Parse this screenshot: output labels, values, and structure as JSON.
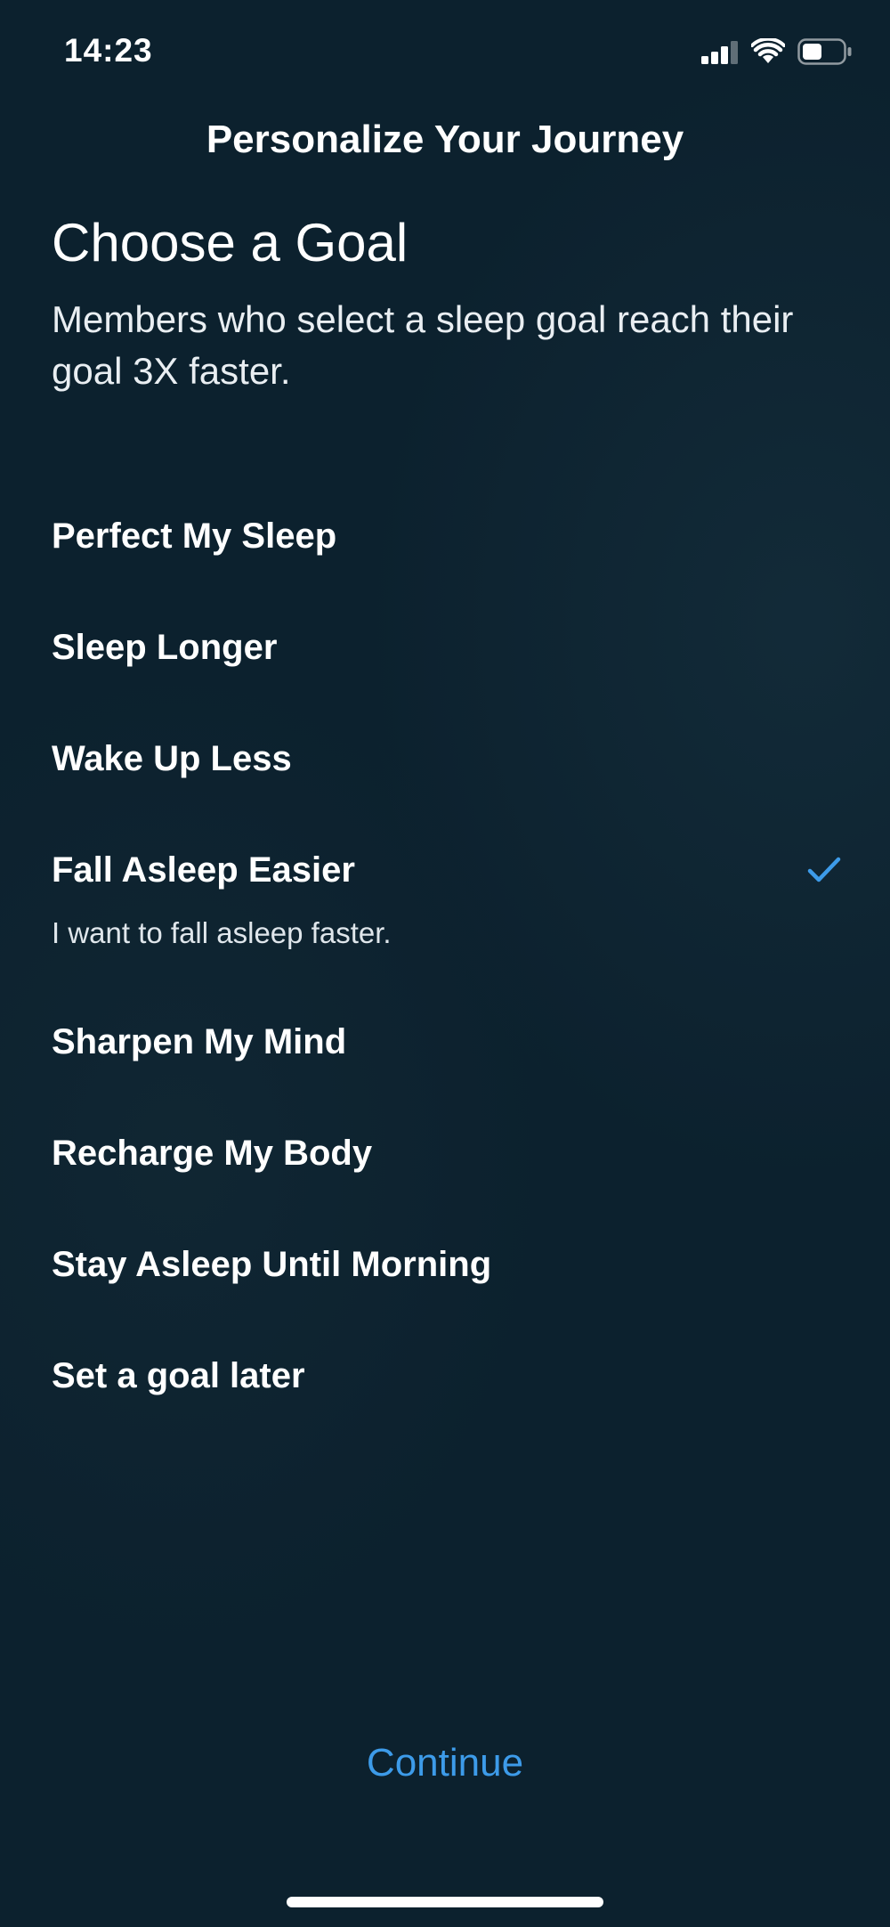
{
  "status_bar": {
    "time": "14:23",
    "icons": [
      "cellular-signal-icon",
      "wifi-icon",
      "battery-icon"
    ]
  },
  "header": {
    "title": "Personalize Your Journey"
  },
  "goal_section": {
    "heading": "Choose a Goal",
    "subtitle": "Members who select a sleep goal reach their goal 3X faster."
  },
  "goals": [
    {
      "label": "Perfect My Sleep",
      "selected": false
    },
    {
      "label": "Sleep Longer",
      "selected": false
    },
    {
      "label": "Wake Up Less",
      "selected": false
    },
    {
      "label": "Fall Asleep Easier",
      "selected": true,
      "description": "I want to fall asleep faster."
    },
    {
      "label": "Sharpen My Mind",
      "selected": false
    },
    {
      "label": "Recharge My Body",
      "selected": false
    },
    {
      "label": "Stay Asleep Until Morning",
      "selected": false
    },
    {
      "label": "Set a goal later",
      "selected": false
    }
  ],
  "footer": {
    "continue_label": "Continue"
  },
  "colors": {
    "background": "#0c212e",
    "accent": "#3d9be9",
    "text": "#ffffff"
  }
}
